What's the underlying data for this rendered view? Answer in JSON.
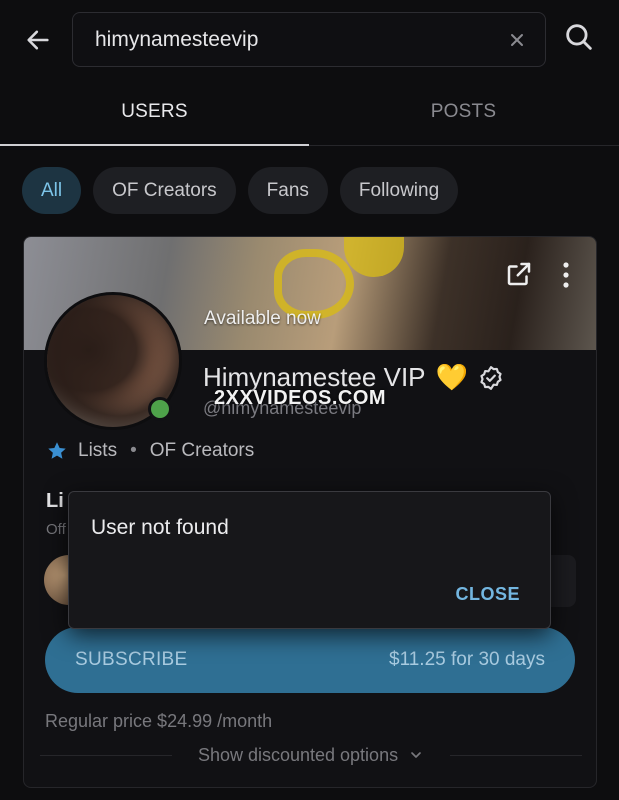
{
  "search": {
    "value": "himynamesteevip",
    "back_icon": "arrow-left-icon",
    "clear_icon": "close-icon",
    "search_icon": "search-icon"
  },
  "tabs": [
    {
      "label": "USERS",
      "active": true
    },
    {
      "label": "POSTS",
      "active": false
    }
  ],
  "filters": [
    {
      "label": "All",
      "selected": true
    },
    {
      "label": "OF Creators",
      "selected": false
    },
    {
      "label": "Fans",
      "selected": false
    },
    {
      "label": "Following",
      "selected": false
    }
  ],
  "profile": {
    "banner_status": "Available now",
    "name": "Himynamestee VIP",
    "name_emoji": "💛",
    "handle": "@himynamesteevip",
    "watermark": "2XXVIDEOS.COM",
    "online": true,
    "lists_label": "Lists",
    "lists_category": "OF Creators",
    "section_title": "Li",
    "section_sub": "Off",
    "subscribe_label": "SUBSCRIBE",
    "subscribe_price": "$11.25 for 30 days",
    "regular_price": "Regular price $24.99 /month",
    "discount_label": "Show discounted options"
  },
  "dialog": {
    "message": "User not found",
    "close_label": "CLOSE"
  },
  "colors": {
    "accent": "#2f6f93",
    "accent_text": "#73b6e0",
    "online": "#4ea24a",
    "star": "#3a8fd1"
  }
}
